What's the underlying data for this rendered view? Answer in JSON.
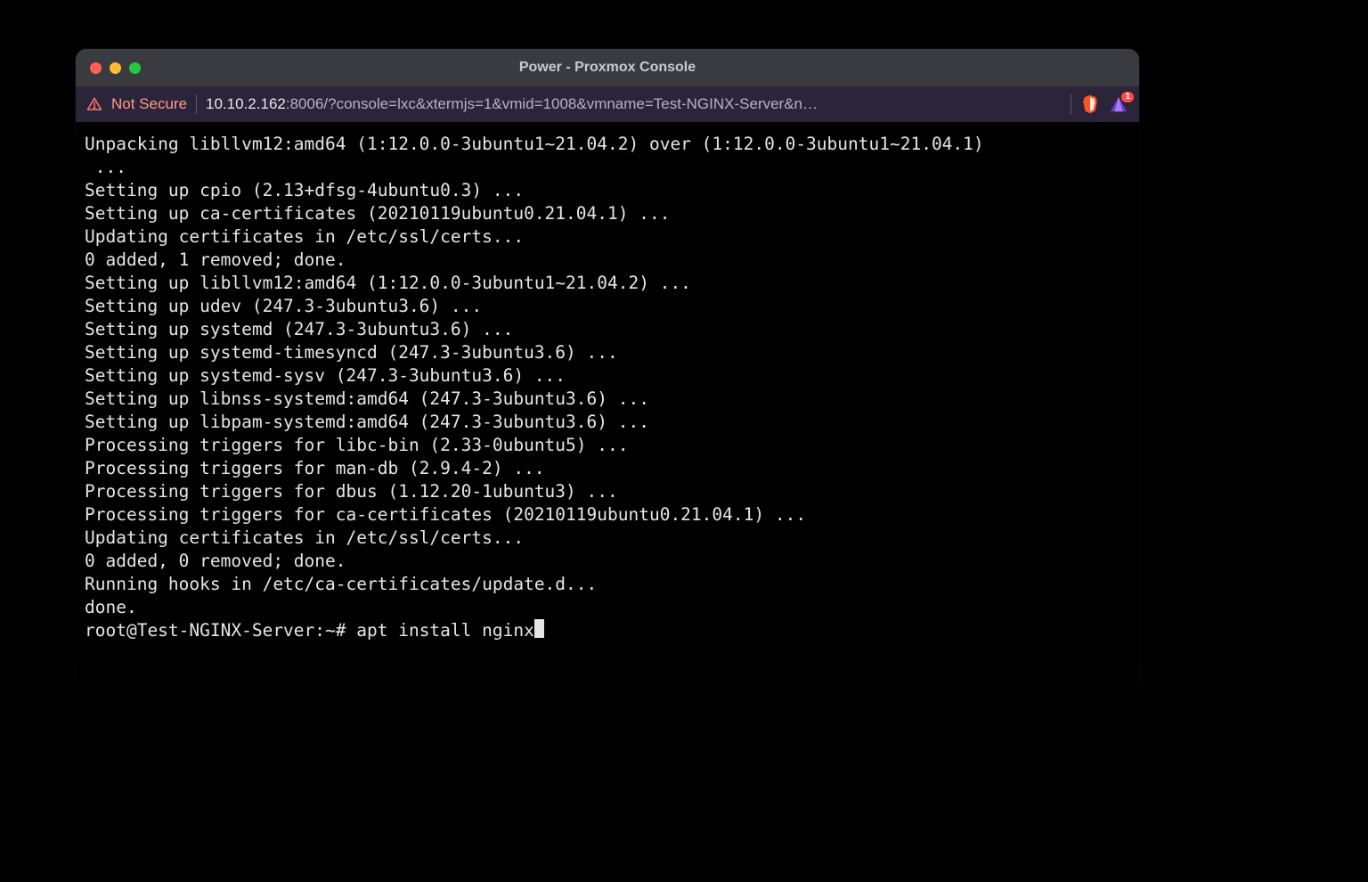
{
  "window": {
    "title": "Power - Proxmox Console"
  },
  "address": {
    "not_secure_label": "Not Secure",
    "host": "10.10.2.162",
    "rest": ":8006/?console=lxc&xtermjs=1&vmid=1008&vmname=Test-NGINX-Server&n…",
    "wallet_badge": "1"
  },
  "terminal": {
    "lines": [
      "Unpacking libllvm12:amd64 (1:12.0.0-3ubuntu1~21.04.2) over (1:12.0.0-3ubuntu1~21.04.1)",
      " ...",
      "Setting up cpio (2.13+dfsg-4ubuntu0.3) ...",
      "Setting up ca-certificates (20210119ubuntu0.21.04.1) ...",
      "Updating certificates in /etc/ssl/certs...",
      "0 added, 1 removed; done.",
      "Setting up libllvm12:amd64 (1:12.0.0-3ubuntu1~21.04.2) ...",
      "Setting up udev (247.3-3ubuntu3.6) ...",
      "Setting up systemd (247.3-3ubuntu3.6) ...",
      "Setting up systemd-timesyncd (247.3-3ubuntu3.6) ...",
      "Setting up systemd-sysv (247.3-3ubuntu3.6) ...",
      "Setting up libnss-systemd:amd64 (247.3-3ubuntu3.6) ...",
      "Setting up libpam-systemd:amd64 (247.3-3ubuntu3.6) ...",
      "Processing triggers for libc-bin (2.33-0ubuntu5) ...",
      "Processing triggers for man-db (2.9.4-2) ...",
      "Processing triggers for dbus (1.12.20-1ubuntu3) ...",
      "Processing triggers for ca-certificates (20210119ubuntu0.21.04.1) ...",
      "Updating certificates in /etc/ssl/certs...",
      "0 added, 0 removed; done.",
      "Running hooks in /etc/ca-certificates/update.d...",
      "done."
    ],
    "prompt": "root@Test-NGINX-Server:~# ",
    "command": "apt install nginx"
  }
}
